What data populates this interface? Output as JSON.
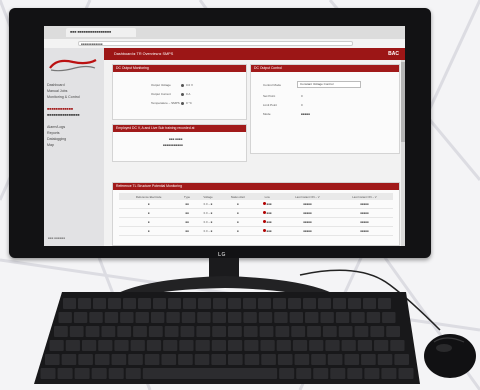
{
  "scene": {
    "monitor_brand": "LG",
    "colors": {
      "brand_red": "#a11a1a",
      "bezel": "#121214",
      "background": "#f4f4f6"
    },
    "icons": [
      "keyboard-icon",
      "mouse-icon",
      "monitor-stand-icon"
    ]
  },
  "screen": {
    "browser": {
      "tab_title": "■■■ ■■■■■■■■■■■■■■■■",
      "address": "■■■■■■■■■■■■"
    },
    "sidebar": {
      "logo": "Infinity",
      "items": [
        "Dashboard",
        "Manual Jobs",
        "Monitoring & Control",
        "■■■■■■■■■■■■",
        "■■■■■■■■■■■■■■■",
        "Alarm/Logs",
        "Reports",
        "Datalogging",
        "Map"
      ],
      "footer": "■■■ ■■■■■■"
    },
    "topbar": {
      "breadcrumb": "Dashboard ▸ TR Overview ▸ SMPS",
      "brand": "BAC"
    },
    "panels": {
      "dc_monitoring": {
        "title": "DC Output Monitoring",
        "rows": [
          {
            "label": "Output Voltage",
            "value": "0.0 V"
          },
          {
            "label": "Output Current",
            "value": "0 A"
          },
          {
            "label": "Temperature – SMPS",
            "value": "0 °C"
          }
        ]
      },
      "dc_control": {
        "title": "DC Output Control",
        "rows": [
          {
            "label": "Control Mode",
            "value": "Constant Voltage Control"
          },
          {
            "label": "Set Point",
            "value": "0"
          },
          {
            "label": "Limit Point",
            "value": "0"
          },
          {
            "label": "Mode",
            "value": "■■■■■"
          }
        ]
      },
      "energy": {
        "title": "Employed DC V, A and Live Sub training recorded at",
        "line1": "■■■ ■■■■",
        "line2": "■■■■■■■■■■■"
      },
      "potential": {
        "title": "Reference TL Structure Potential Monitoring",
        "columns": [
          "Reference Electrode",
          "Type",
          "Voltage",
          "Status Alert",
          "Low",
          "Last Instant ON – V",
          "Last Instant ON – V"
        ],
        "rows": [
          [
            "■",
            "■■",
            "0.0 – ■",
            "■",
            "■■■",
            "■■■■■",
            "■■■■■"
          ],
          [
            "■",
            "■■",
            "0.0 – ■",
            "■",
            "■■■",
            "■■■■■",
            "■■■■■"
          ],
          [
            "■",
            "■■",
            "0.0 – ■",
            "■",
            "■■■",
            "■■■■■",
            "■■■■■"
          ],
          [
            "■",
            "■■",
            "0.0 – ■",
            "■",
            "■■■",
            "■■■■■",
            "■■■■■"
          ]
        ]
      },
      "bottom": {
        "title": "■■■■ ■■■■■■■■"
      }
    }
  }
}
